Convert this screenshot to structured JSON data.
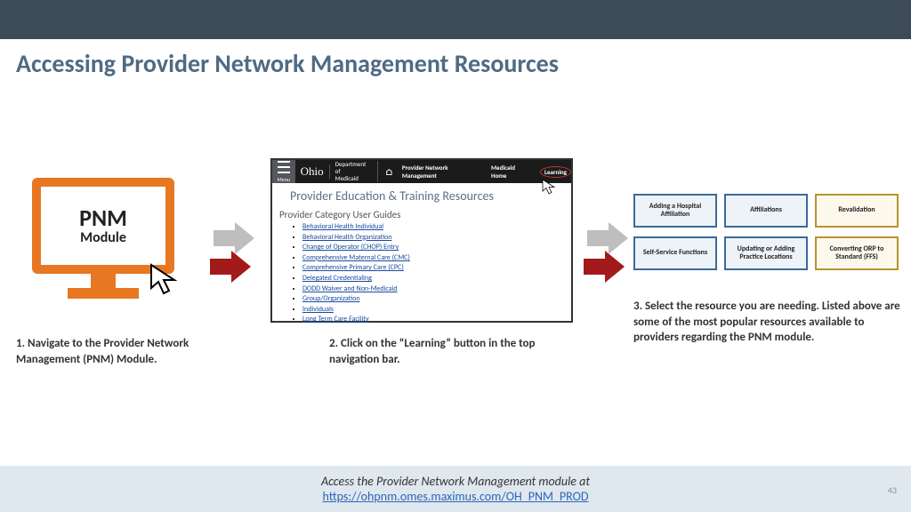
{
  "title": "Accessing Provider Network Management Resources",
  "monitor": {
    "line1": "PNM",
    "line2": "Module"
  },
  "shot": {
    "menu_label": "Menu",
    "logo": "Ohio",
    "dept": "Department of\nMedicaid",
    "nav": {
      "pnm": "Provider Network Management",
      "medhome": "Medicaid Home",
      "learning": "Learning"
    },
    "h1": "Provider Education & Training Resources",
    "h2": "Provider Category User Guides",
    "links": [
      "Behavioral Health Individual",
      "Behavioral Health Organization",
      "Change of Operator (CHOP) Entry",
      "Comprehensive Maternal Care (CMC)",
      "Comprehensive Primary Care (CPC)",
      "Delegated Credentialing",
      "DODD Waiver and Non-Medicaid",
      "Group/Organization",
      "Individuals",
      "Long Term Care Facility"
    ]
  },
  "tiles": [
    "Adding a Hospital Affiliation",
    "Affiliations",
    "Revalidation",
    "Self-Service Functions",
    "Updating or Adding Practice Locations",
    "Converting ORP to Standard (FFS)"
  ],
  "captions": {
    "c1": "1. Navigate to the Provider Network Management (PNM) Module.",
    "c2": "2. Click on the “Learning” button in the top navigation bar.",
    "c3": "3. Select the resource you are needing. Listed above are some of the most popular resources available to providers regarding the PNM module."
  },
  "footer": {
    "line1": "Access the Provider Network Management module at",
    "url": "https://ohpnm.omes.maximus.com/OH_PNM_PROD"
  },
  "page_number": "43"
}
